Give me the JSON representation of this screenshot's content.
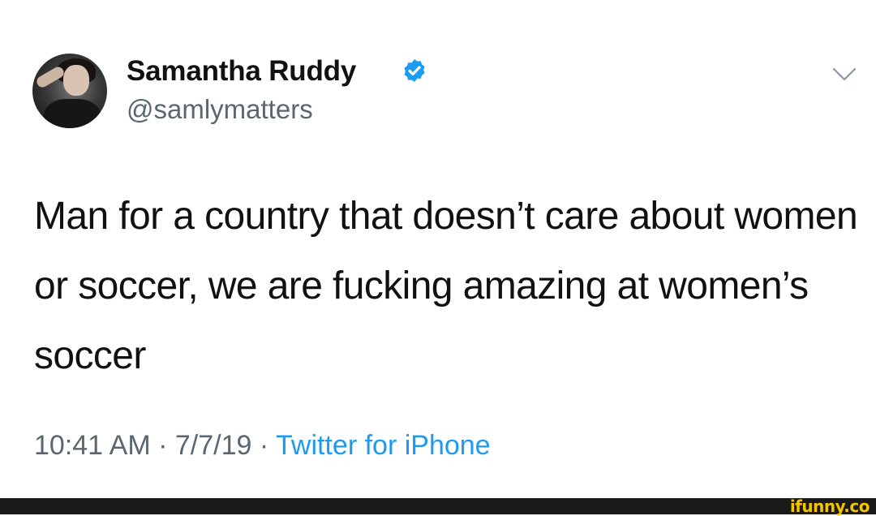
{
  "user": {
    "display_name": "Samantha Ruddy",
    "handle": "@samlymatters",
    "verified": true
  },
  "tweet": {
    "text": "Man for a country that doesn’t care about women or soccer, we are fucking amazing at women’s soccer",
    "time": "10:41 AM",
    "date": "7/7/19",
    "separator": " · ",
    "source": "Twitter for iPhone"
  },
  "watermark": {
    "text": "ifunny.co"
  },
  "colors": {
    "verified_blue": "#1d9bf0",
    "meta_gray": "#5b6770",
    "watermark_yellow": "#f5c400"
  },
  "icons": [
    "verified-badge-icon",
    "chevron-down-icon"
  ]
}
